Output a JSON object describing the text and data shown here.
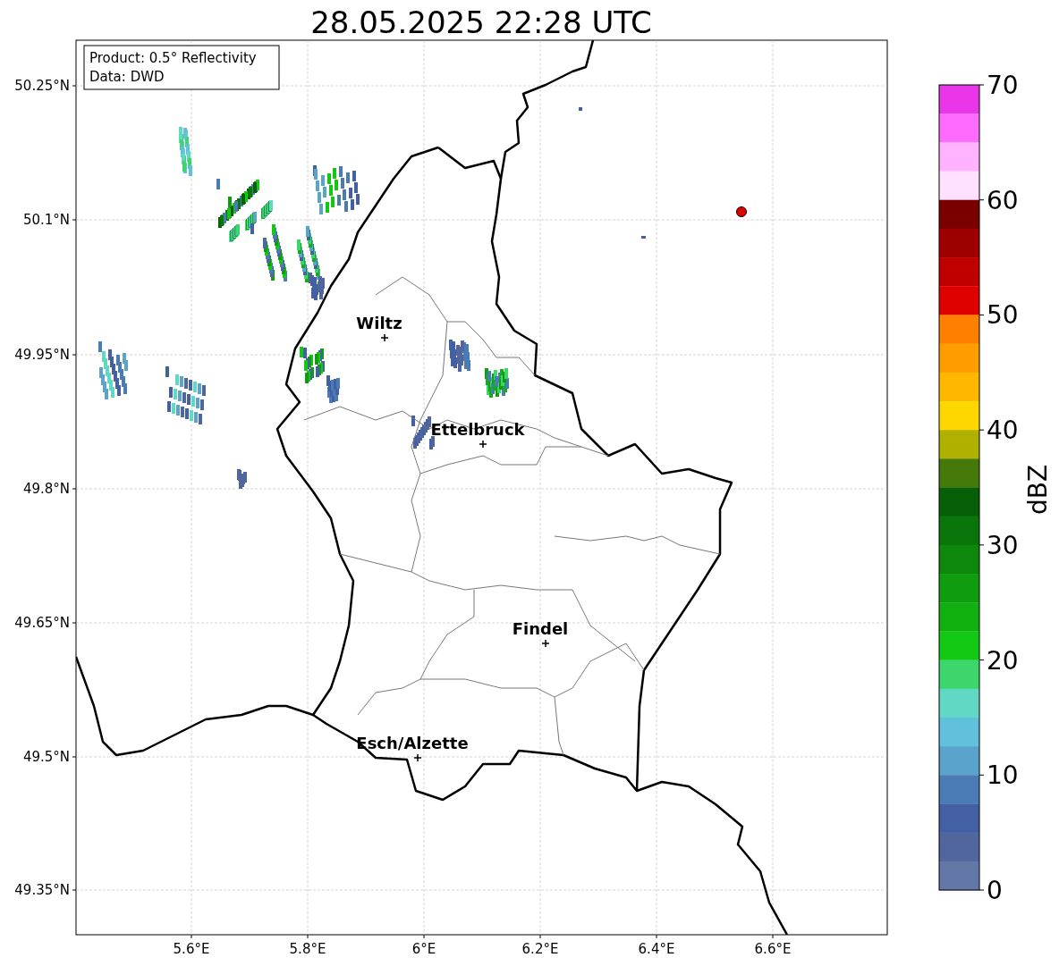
{
  "title": "28.05.2025 22:28 UTC",
  "info_box": [
    "Product: 0.5° Reflectivity",
    "Data: DWD"
  ],
  "lat_ticks": [
    "50.25°N",
    "50.1°N",
    "49.95°N",
    "49.8°N",
    "49.65°N",
    "49.5°N",
    "49.35°N"
  ],
  "lon_ticks": [
    "5.6°E",
    "5.8°E",
    "6°E",
    "6.2°E",
    "6.4°E",
    "6.6°E"
  ],
  "cities": [
    {
      "name": "Wiltz"
    },
    {
      "name": "Ettelbruck"
    },
    {
      "name": "Findel"
    },
    {
      "name": "Esch/Alzette"
    }
  ],
  "colorbar": {
    "label": "dBZ",
    "ticks": [
      "70",
      "60",
      "50",
      "40",
      "30",
      "20",
      "10",
      "0"
    ],
    "levels": [
      {
        "color": "#e936e9"
      },
      {
        "color": "#ff6aff"
      },
      {
        "color": "#ffb3ff"
      },
      {
        "color": "#ffe0ff"
      },
      {
        "color": "#7a0000"
      },
      {
        "color": "#9e0000"
      },
      {
        "color": "#c00000"
      },
      {
        "color": "#e00000"
      },
      {
        "color": "#ff7f00"
      },
      {
        "color": "#ff9c00"
      },
      {
        "color": "#ffb700"
      },
      {
        "color": "#ffd700"
      },
      {
        "color": "#b0b000"
      },
      {
        "color": "#457a0a"
      },
      {
        "color": "#075f07"
      },
      {
        "color": "#0a750a"
      },
      {
        "color": "#0d880d"
      },
      {
        "color": "#0f9c0f"
      },
      {
        "color": "#10b010"
      },
      {
        "color": "#12c812"
      },
      {
        "color": "#3dd66d"
      },
      {
        "color": "#61d8c4"
      },
      {
        "color": "#61c0dc"
      },
      {
        "color": "#5aa3cc"
      },
      {
        "color": "#4a7bb5"
      },
      {
        "color": "#4460a4"
      },
      {
        "color": "#50669c"
      },
      {
        "color": "#6478a8"
      }
    ]
  }
}
